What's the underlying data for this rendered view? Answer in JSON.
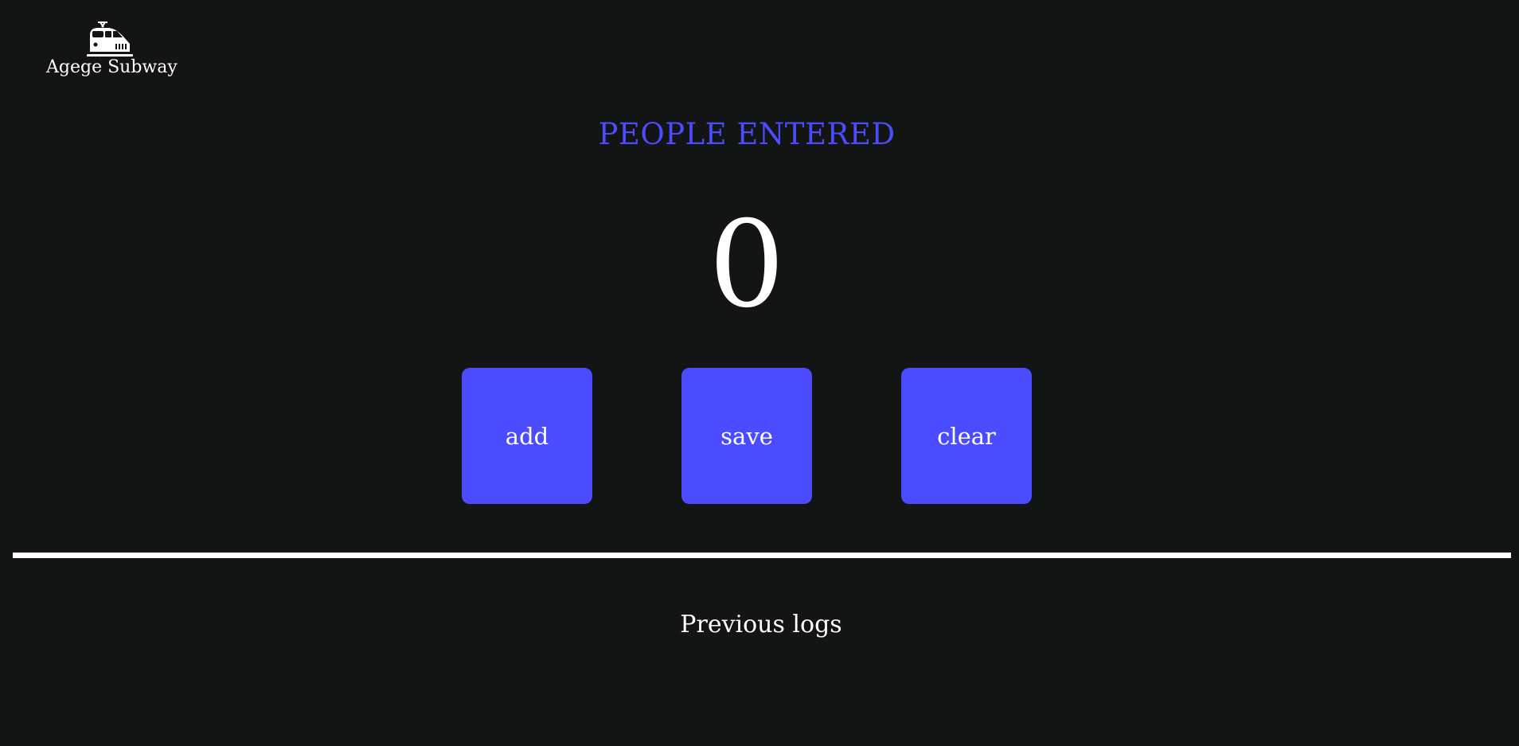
{
  "brand": {
    "name": "Agege Subway",
    "icon": "train-icon"
  },
  "counter": {
    "title": "PEOPLE ENTERED",
    "value": "0",
    "title_color": "#4b4bff"
  },
  "actions": {
    "add_label": "add",
    "save_label": "save",
    "clear_label": "clear",
    "button_color": "#4b4bff"
  },
  "logs": {
    "title": "Previous logs",
    "entries": []
  },
  "theme": {
    "background": "#131414",
    "text": "#ffffff"
  }
}
